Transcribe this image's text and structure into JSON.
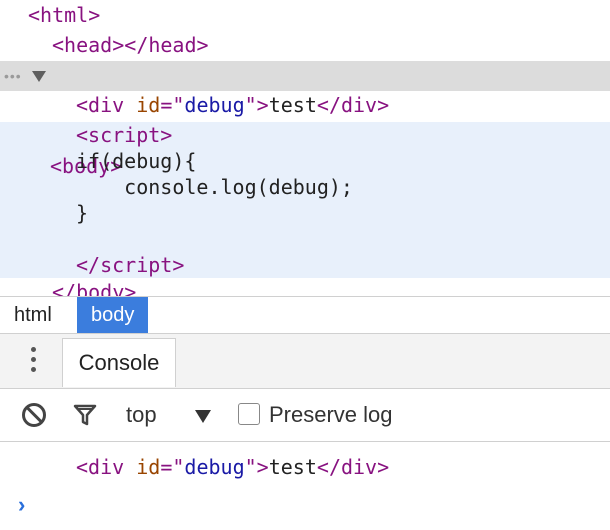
{
  "elements_tree": {
    "html_open": "html",
    "head_open": "head",
    "head_close": "/head",
    "body_open": "body",
    "div_tag": "div",
    "div_attr_name": "id",
    "div_attr_value": "debug",
    "div_text": "test",
    "div_close": "/div",
    "script_open": "script",
    "script_lines": [
      "if(debug){",
      "    console.log(debug);",
      "}",
      ""
    ],
    "script_close": "/script",
    "body_close_partial": "/body"
  },
  "breadcrumbs": [
    "html",
    "body"
  ],
  "drawer": {
    "tab_label": "Console"
  },
  "console_toolbar": {
    "context": "top",
    "preserve_log_label": "Preserve log",
    "preserve_log_checked": false
  },
  "console_output": {
    "div_tag": "div",
    "attr_name": "id",
    "attr_value": "debug",
    "text": "test",
    "close": "/div"
  },
  "colors": {
    "tag": "#881280",
    "attribute": "#994500",
    "attribute_value": "#1a1aa6",
    "selection": "#3b7ddd",
    "prompt": "#2a6fdb"
  },
  "icons": [
    "expand-triangle-icon",
    "more-vertical-icon",
    "clear-console-icon",
    "filter-icon",
    "dropdown-arrow-icon",
    "console-prompt-icon"
  ]
}
